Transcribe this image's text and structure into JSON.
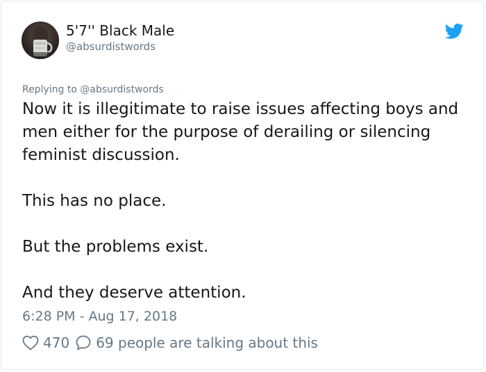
{
  "user": {
    "display_name": "5'7'' Black Male",
    "handle": "@absurdistwords"
  },
  "tweet": {
    "replying_to": "Replying to @absurdistwords",
    "paragraphs": [
      "Now it is illegitimate to raise issues affecting boys and men either for the purpose of derailing or silencing feminist discussion.",
      "This has no place.",
      "But the problems exist.",
      "And they deserve attention."
    ],
    "timestamp": "6:28 PM - Aug 17, 2018"
  },
  "engagement": {
    "likes": "470",
    "talking": "69 people are talking about this"
  },
  "icons": {
    "brand": "twitter-bird-icon",
    "like": "heart-icon",
    "reply": "speech-bubble-icon"
  },
  "colors": {
    "brand_blue": "#1da1f2",
    "text_primary": "#14171a",
    "text_secondary": "#657786",
    "border": "#e1e8ed"
  }
}
